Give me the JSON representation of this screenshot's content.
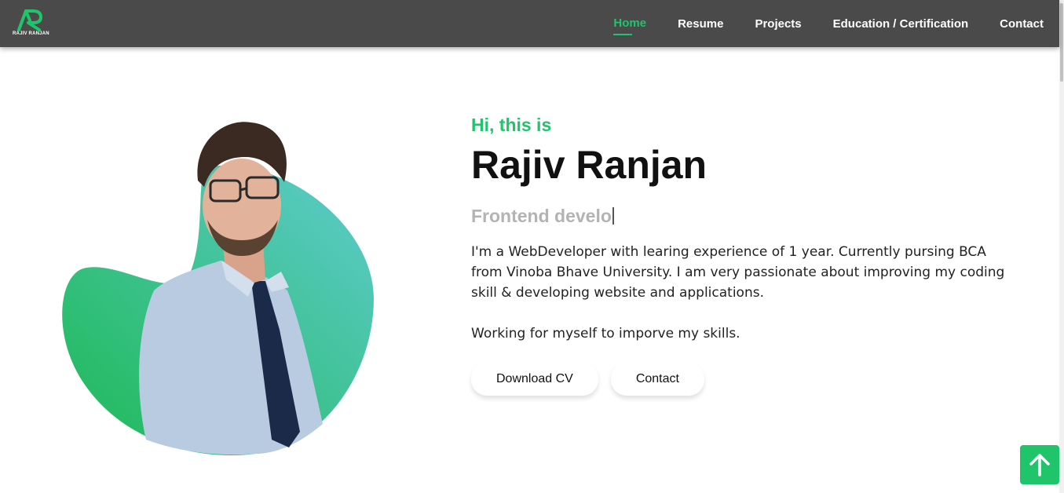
{
  "logo": {
    "text": "RAJIV RANJAN",
    "icon": "ar-monogram-logo"
  },
  "nav": {
    "items": [
      {
        "label": "Home",
        "active": true
      },
      {
        "label": "Resume"
      },
      {
        "label": "Projects"
      },
      {
        "label": "Education / Certification"
      },
      {
        "label": "Contact"
      }
    ]
  },
  "hero": {
    "greeting": "Hi, this is",
    "name": "Rajiv Ranjan",
    "role_typed": "Frontend develo",
    "bio": "I'm a WebDeveloper with learing experience of 1 year. Currently pursing BCA from Vinoba Bhave University. I am very passionate about improving my coding skill & developing website and applications.",
    "bio2": "Working for myself to imporve my skills.",
    "buttons": {
      "download_cv": "Download CV",
      "contact": "Contact"
    }
  },
  "scroll_top": {
    "icon": "arrow-up-icon"
  },
  "colors": {
    "accent": "#1fc46b",
    "navbar": "#4a4a4a",
    "blob_start": "#1db954",
    "blob_end": "#5fcbcf"
  }
}
